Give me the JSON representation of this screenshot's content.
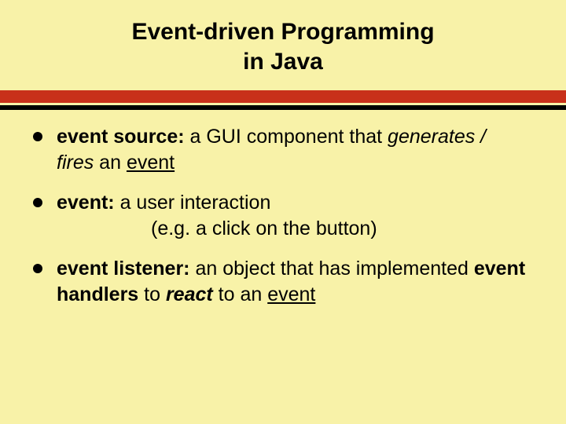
{
  "title_line1": "Event-driven Programming",
  "title_line2": "in Java",
  "bullets": {
    "b1": {
      "term": "event source:",
      "desc1": " a GUI component that ",
      "em1": "generates / fires",
      "desc2": " an ",
      "u1": "event"
    },
    "b2": {
      "term": "event:",
      "desc1": " a user interaction",
      "sub": "(e.g. a click on the button)"
    },
    "b3": {
      "term": "event listener:",
      "desc1": " an object that has implemented ",
      "bold2": "event handlers",
      "desc2": " to ",
      "em1": "react",
      "desc3": " to an ",
      "u1": "event"
    }
  }
}
